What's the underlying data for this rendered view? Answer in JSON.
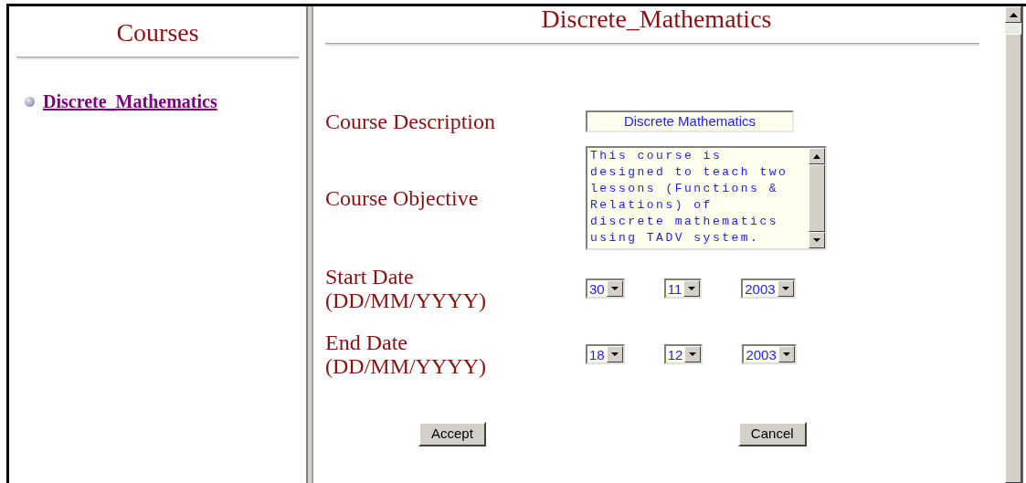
{
  "sidebar": {
    "title": "Courses",
    "items": [
      {
        "label": "Discrete_Mathematics"
      }
    ]
  },
  "main": {
    "title": "Discrete_Mathematics",
    "fields": [
      {
        "kind": "text",
        "label": "Course Description",
        "value": "Discrete Mathematics"
      },
      {
        "kind": "textarea",
        "label": "Course Objective",
        "value": "This course is designed to teach two lessons (Functions & Relations) of discrete mathematics using TADV system."
      },
      {
        "kind": "date",
        "label": "Start Date",
        "hint": "(DD/MM/YYYY)",
        "parts": [
          "30",
          "11",
          "2003"
        ]
      },
      {
        "kind": "date",
        "label": "End Date",
        "hint": "(DD/MM/YYYY)",
        "parts": [
          "18",
          "12",
          "2003"
        ]
      }
    ],
    "buttons": [
      "Accept",
      "Cancel"
    ]
  }
}
